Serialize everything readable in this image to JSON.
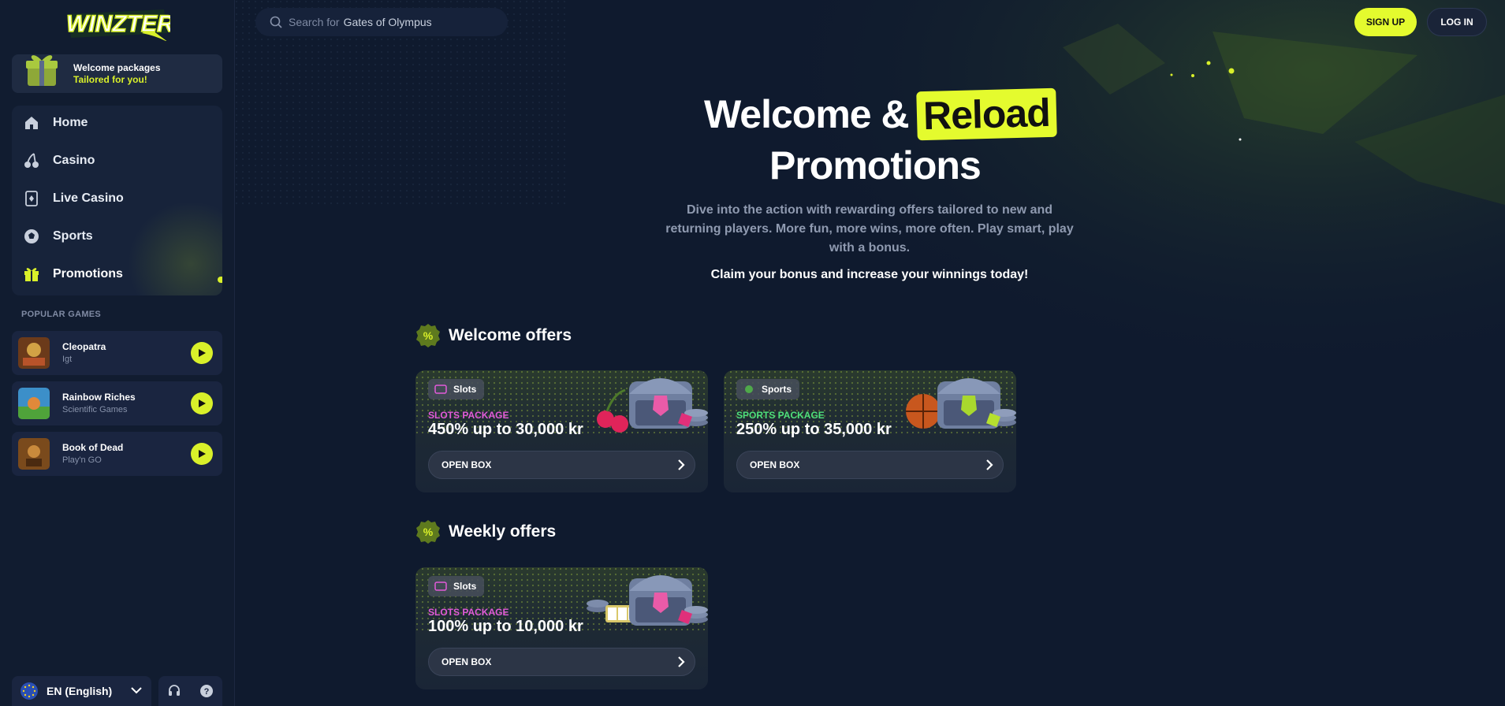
{
  "brand": {
    "logo_text": "WINZTER",
    "accent": "#e4fb2e"
  },
  "sidebar": {
    "welcome": {
      "line1": "Welcome packages",
      "line2": "Tailored for you!"
    },
    "nav": [
      {
        "label": "Home",
        "icon": "home-icon"
      },
      {
        "label": "Casino",
        "icon": "cherries-icon"
      },
      {
        "label": "Live Casino",
        "icon": "cards-icon"
      },
      {
        "label": "Sports",
        "icon": "soccer-ball-icon"
      },
      {
        "label": "Promotions",
        "icon": "gift-icon"
      }
    ],
    "popular_title": "POPULAR GAMES",
    "games": [
      {
        "name": "Cleopatra",
        "provider": "Igt"
      },
      {
        "name": "Rainbow Riches",
        "provider": "Scientific Games"
      },
      {
        "name": "Book of Dead",
        "provider": "Play'n GO"
      }
    ],
    "language": "EN (English)"
  },
  "header": {
    "search_prefix": "Search for",
    "search_value": "Gates of Olympus",
    "signup": "SIGN UP",
    "login": "LOG IN"
  },
  "hero": {
    "title_part1": "Welcome &",
    "title_highlight": "Reload",
    "title_line2": "Promotions",
    "description": "Dive into the action with rewarding offers tailored to new and returning players. More fun, more wins, more often. Play smart, play with a bonus.",
    "claim": "Claim your bonus and increase your winnings today!"
  },
  "sections": {
    "welcome": {
      "title": "Welcome offers",
      "cards": [
        {
          "tag": "Slots",
          "package_label": "SLOTS PACKAGE",
          "package_color": "#e25bd9",
          "amount": "450% up to 30,000 kr",
          "button": "OPEN BOX"
        },
        {
          "tag": "Sports",
          "package_label": "SPORTS PACKAGE",
          "package_color": "#4fe07a",
          "amount": "250% up to 35,000 kr",
          "button": "OPEN BOX"
        }
      ]
    },
    "weekly": {
      "title": "Weekly offers",
      "cards": [
        {
          "tag": "Slots",
          "package_label": "SLOTS PACKAGE",
          "package_color": "#e25bd9",
          "amount": "100% up to 10,000 kr",
          "button": "OPEN BOX"
        }
      ]
    }
  }
}
